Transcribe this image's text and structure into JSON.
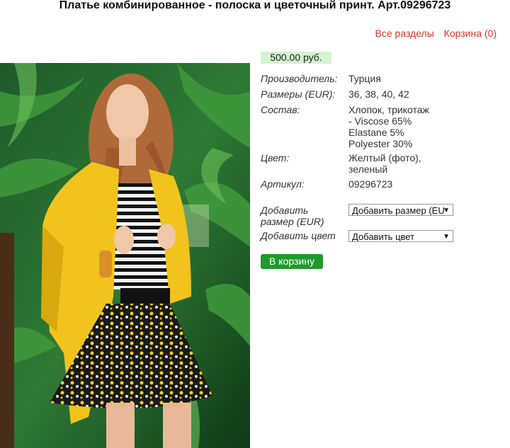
{
  "page": {
    "title": "Платье комбинированное - полоска и цветочный принт. Арт.09296723"
  },
  "nav": {
    "all_sections": "Все разделы",
    "cart": "Корзина (0)"
  },
  "product": {
    "price": "500.00 руб.",
    "specs": {
      "manufacturer_label": "Производитель:",
      "manufacturer_value": "Турция",
      "sizes_label": "Размеры (EUR):",
      "sizes_value": "36, 38, 40, 42",
      "composition_label": "Состав:",
      "composition_lines": [
        "Хлопок, трикотаж",
        "- Viscose 65%",
        "Elastane 5%",
        "Polyester 30%"
      ],
      "color_label": "Цвет:",
      "color_lines": [
        "Желтый (фото),",
        "зеленый"
      ],
      "article_label": "Артикул:",
      "article_value": "09296723"
    },
    "add_size": {
      "label_lines": [
        "Добавить",
        "размер (EUR)"
      ],
      "selected": "Добавить размер (EUR)"
    },
    "add_color": {
      "label": "Добавить цвет",
      "selected": "Добавить цвет"
    },
    "cart_button": "В корзину"
  },
  "colors": {
    "accent_link": "#e0302a",
    "price_bg": "#d4f3d0",
    "button_bg": "#1e9a2c"
  }
}
